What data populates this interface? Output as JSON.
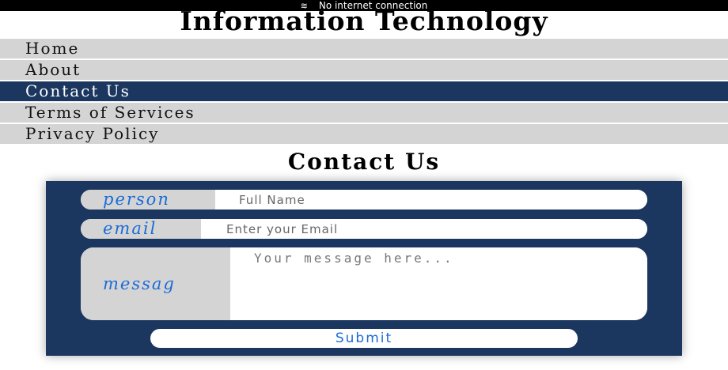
{
  "status_bar": {
    "icon": "wifi-off-icon",
    "text": "No internet connection"
  },
  "site": {
    "title": "Information Technology"
  },
  "nav": {
    "items": [
      {
        "label": "Home",
        "active": false
      },
      {
        "label": "About",
        "active": false
      },
      {
        "label": "Contact Us",
        "active": true
      },
      {
        "label": "Terms of Services",
        "active": false
      },
      {
        "label": "Privacy Policy",
        "active": false
      }
    ]
  },
  "contact": {
    "heading": "Contact Us",
    "name_label": "person",
    "name_placeholder": "Full Name",
    "email_label": "email",
    "email_placeholder": "Enter your Email",
    "message_label": "messag",
    "message_placeholder": "Your message here...",
    "submit_label": "Submit"
  },
  "colors": {
    "accent": "#1b365f",
    "label_text": "#1a6bd8",
    "nav_bg": "#d4d4d4",
    "bottom_text": "#d91a1a"
  }
}
